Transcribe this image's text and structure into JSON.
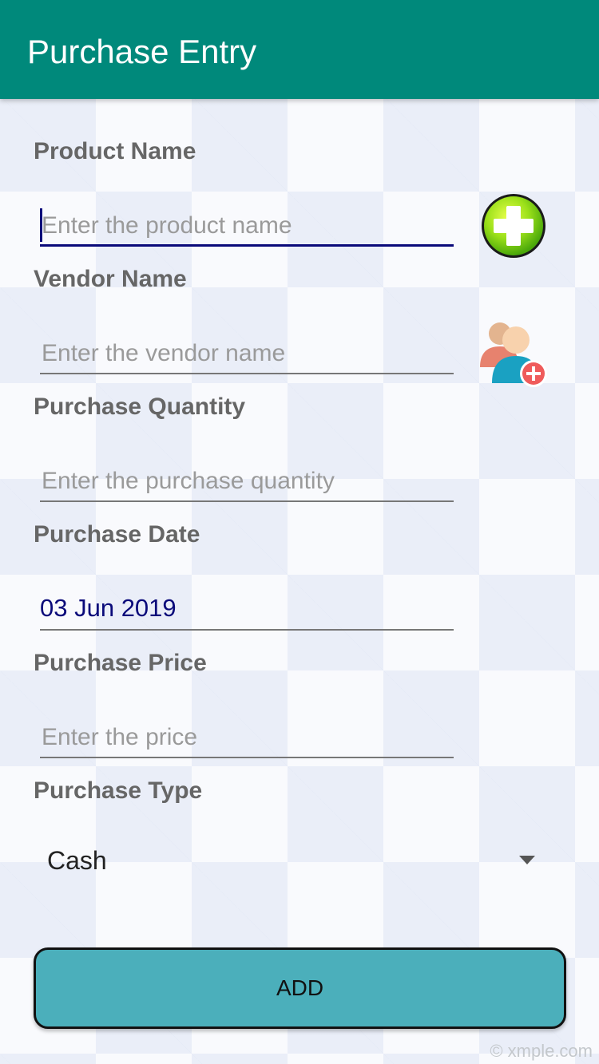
{
  "app_bar": {
    "title": "Purchase Entry",
    "color": "#00897b"
  },
  "form": {
    "product_name": {
      "label": "Product Name",
      "placeholder": "Enter the product name",
      "value": ""
    },
    "vendor_name": {
      "label": "Vendor Name",
      "placeholder": "Enter the vendor name",
      "value": ""
    },
    "purchase_quantity": {
      "label": "Purchase Quantity",
      "placeholder": "Enter the purchase quantity",
      "value": ""
    },
    "purchase_date": {
      "label": "Purchase Date",
      "value": "03 Jun 2019"
    },
    "purchase_price": {
      "label": "Purchase Price",
      "placeholder": "Enter the price",
      "value": ""
    },
    "purchase_type": {
      "label": "Purchase Type",
      "selected": "Cash"
    }
  },
  "icons": {
    "add_product": "plus-circle-icon",
    "add_vendor": "add-user-icon",
    "dropdown": "dropdown-arrow-icon"
  },
  "actions": {
    "add_label": "ADD",
    "add_color": "#4bafbb"
  },
  "watermark": "© xmple.com"
}
